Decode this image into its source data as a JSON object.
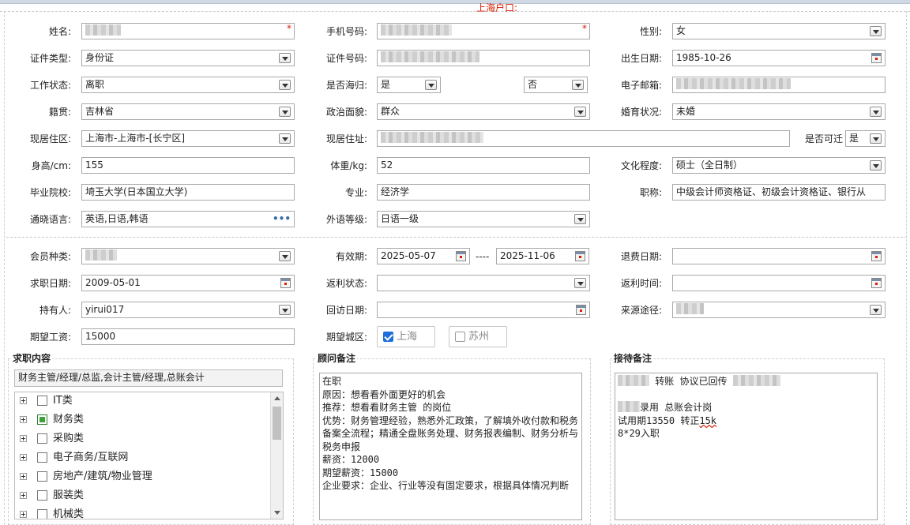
{
  "row1": {
    "name": {
      "label": "姓名:",
      "value": ""
    },
    "phone": {
      "label": "手机号码:",
      "value": ""
    },
    "gender": {
      "label": "性别:",
      "value": "女"
    },
    "required_mark": "*"
  },
  "row2": {
    "id_type": {
      "label": "证件类型:",
      "value": "身份证"
    },
    "id_number": {
      "label": "证件号码:",
      "value": ""
    },
    "birth": {
      "label": "出生日期:",
      "value": "1985-10-26"
    }
  },
  "row3": {
    "work_status": {
      "label": "工作状态:",
      "value": "离职"
    },
    "returnee": {
      "label": "是否海归:",
      "value": "是"
    },
    "shanghai_hukou": {
      "label": "上海户口:",
      "value": "否"
    },
    "email": {
      "label": "电子邮箱:",
      "value": ""
    }
  },
  "row4": {
    "native": {
      "label": "籍贯:",
      "value": "吉林省"
    },
    "political": {
      "label": "政治面貌:",
      "value": "群众"
    },
    "marital": {
      "label": "婚育状况:",
      "value": "未婚"
    }
  },
  "row5": {
    "residence_area": {
      "label": "现居住区:",
      "value": "上海市-上海市-[长宁区]"
    },
    "residence_addr": {
      "label": "现居住址:",
      "value": ""
    },
    "relocate": {
      "label": "是否可迁",
      "value": "是"
    }
  },
  "row6": {
    "height": {
      "label": "身高/cm:",
      "value": "155"
    },
    "weight": {
      "label": "体重/kg:",
      "value": "52"
    },
    "education": {
      "label": "文化程度:",
      "value": "硕士（全日制）"
    }
  },
  "row7": {
    "school": {
      "label": "毕业院校:",
      "value": "埼玉大学(日本国立大学)"
    },
    "major": {
      "label": "专业:",
      "value": "经济学"
    },
    "title": {
      "label": "职称:",
      "value": "中级会计师资格证、初级会计资格证、银行从"
    }
  },
  "row8": {
    "languages": {
      "label": "通晓语言:",
      "value": "英语,日语,韩语",
      "more": "•••"
    },
    "foreign_level": {
      "label": "外语等级:",
      "value": "日语一级"
    }
  },
  "member": {
    "type": {
      "label": "会员种类:",
      "value": ""
    },
    "valid": {
      "label": "有效期:",
      "from": "2025-05-07",
      "sep": "----",
      "to": "2025-11-06"
    },
    "refund_date": {
      "label": "退费日期:",
      "value": ""
    },
    "job_date": {
      "label": "求职日期:",
      "value": "2009-05-01"
    },
    "rebate_status": {
      "label": "返利状态:",
      "value": ""
    },
    "rebate_time": {
      "label": "返利时间:",
      "value": ""
    },
    "holder": {
      "label": "持有人:",
      "value": "yirui017"
    },
    "visit_date": {
      "label": "回访日期:",
      "value": ""
    },
    "source": {
      "label": "来源途径:",
      "value": ""
    },
    "salary": {
      "label": "期望工资:",
      "value": "15000"
    },
    "city_label": "期望城区:",
    "cities": [
      {
        "label": "上海",
        "checked": true
      },
      {
        "label": "苏州",
        "checked": false
      }
    ]
  },
  "job_panel": {
    "title": "求职内容",
    "summary": "财务主管/经理/总监,会计主管/经理,总账会计",
    "tree": [
      {
        "label": "IT类",
        "checked": false
      },
      {
        "label": "财务类",
        "checked": true
      },
      {
        "label": "采购类",
        "checked": false
      },
      {
        "label": "电子商务/互联网",
        "checked": false
      },
      {
        "label": "房地产/建筑/物业管理",
        "checked": false
      },
      {
        "label": "服装类",
        "checked": false
      },
      {
        "label": "机械类",
        "checked": false
      }
    ]
  },
  "advisor_panel": {
    "title": "顾问备注",
    "lines": [
      "在职",
      "原因：想看看外面更好的机会",
      "推荐：想看看财务主管 的岗位",
      "优势：财务管理经验，熟悉外汇政策，了解填外收付款和税务备案全流程；精通全盘账务处理、财务报表编制、财务分析与税务申报",
      "薪资：12000",
      "期望薪资：15000",
      "企业要求：企业、行业等没有固定要求，根据具体情况判断"
    ]
  },
  "reception_panel": {
    "title": "接待备注",
    "line1_a": "转账 协议已回传",
    "line2_a": "录用 总账会计岗",
    "line3_a": "试用期13550 转正",
    "line3_b": "15k",
    "line4": "8*29入职"
  }
}
